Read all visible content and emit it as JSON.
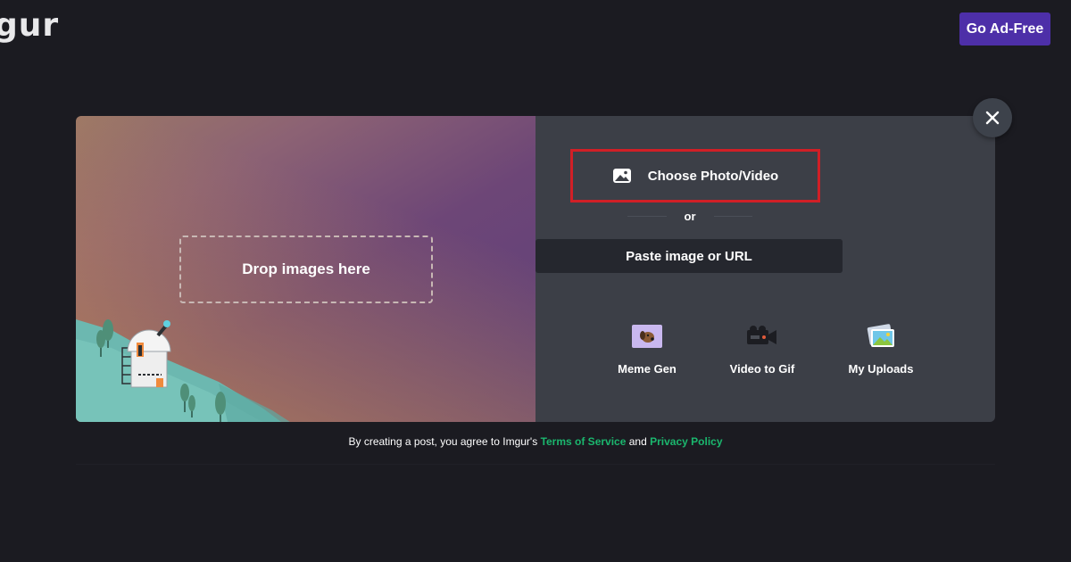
{
  "header": {
    "logo_text": "gur",
    "go_adfree_label": "Go Ad-Free"
  },
  "modal": {
    "drop_zone_label": "Drop images here",
    "choose_label": "Choose Photo/Video",
    "or_label": "or",
    "paste_label": "Paste image or URL",
    "tools": [
      {
        "label": "Meme Gen",
        "icon": "meme-gen-icon"
      },
      {
        "label": "Video to Gif",
        "icon": "video-camera-icon"
      },
      {
        "label": "My Uploads",
        "icon": "photos-icon"
      }
    ]
  },
  "footer": {
    "prefix": "By creating a post, you agree to Imgur's",
    "terms_label": "Terms of Service",
    "and_label": "and",
    "privacy_label": "Privacy Policy"
  },
  "colors": {
    "accent_purple": "#4d2fa8",
    "link_green": "#1bb76e",
    "highlight_red": "#d11f26",
    "background": "#1b1b21",
    "panel": "#3c3f47"
  }
}
